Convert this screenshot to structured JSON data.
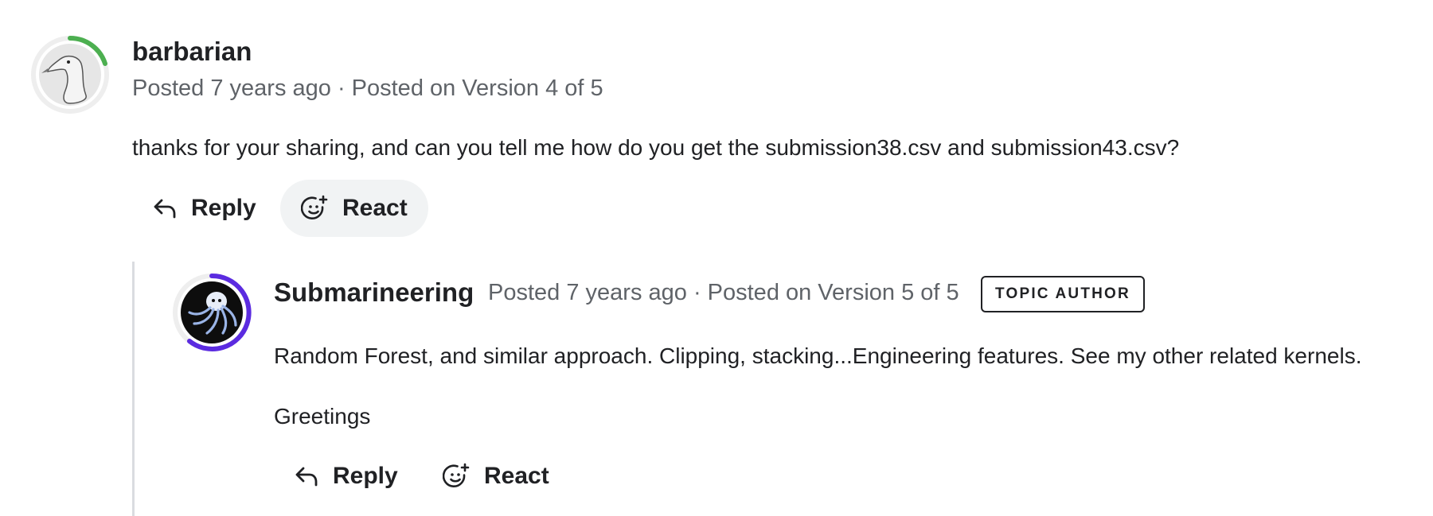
{
  "comment": {
    "author": "barbarian",
    "meta": "Posted 7 years ago · Posted on Version 4 of 5",
    "text": "thanks for your sharing, and can you tell me how do you get the submission38.csv and submission43.csv?",
    "reply_label": "Reply",
    "react_label": "React",
    "ring_color": "#4caf50"
  },
  "reply": {
    "author": "Submarineering",
    "meta": "Posted 7 years ago · Posted on Version 5 of 5",
    "badge": "TOPIC AUTHOR",
    "paragraphs": [
      "Random Forest, and similar approach. Clipping, stacking...Engineering features. See my other related kernels.",
      "Greetings"
    ],
    "reply_label": "Reply",
    "react_label": "React",
    "ring_color": "#5b2be0"
  }
}
